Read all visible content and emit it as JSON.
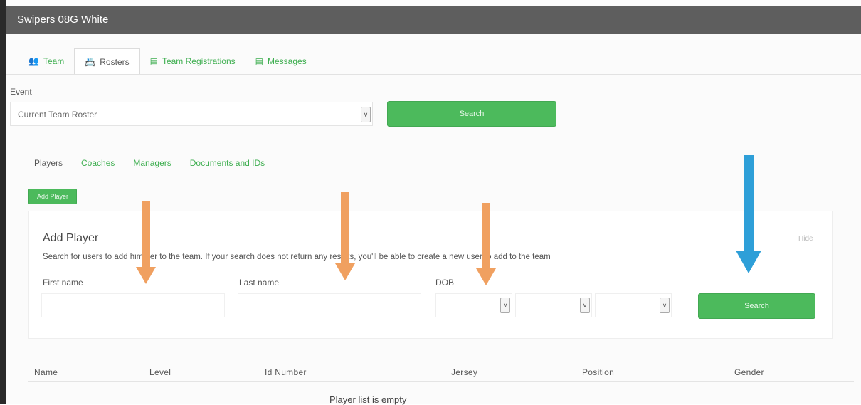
{
  "window": {
    "title": "Swipers 08G White"
  },
  "tabs": [
    {
      "label": "Team",
      "icon": "team-icon",
      "active": false
    },
    {
      "label": "Rosters",
      "icon": "roster-card-icon",
      "active": true
    },
    {
      "label": "Team Registrations",
      "icon": "list-icon",
      "active": false
    },
    {
      "label": "Messages",
      "icon": "list-icon",
      "active": false
    }
  ],
  "event": {
    "label": "Event",
    "selected": "Current Team Roster",
    "search_label": "Search"
  },
  "subtabs": [
    {
      "label": "Players",
      "active": true
    },
    {
      "label": "Coaches",
      "active": false
    },
    {
      "label": "Managers",
      "active": false
    },
    {
      "label": "Documents and IDs",
      "active": false
    }
  ],
  "add_player_button": "Add Player",
  "add_player": {
    "title": "Add Player",
    "hide_label": "Hide",
    "description": "Search for users to add him/her to the team. If your search does not return any results, you'll be able to create a new user to add to the team",
    "first_name_label": "First name",
    "last_name_label": "Last name",
    "dob_label": "DOB",
    "search_label": "Search"
  },
  "table": {
    "columns": [
      "Name",
      "Level",
      "Id Number",
      "Jersey",
      "Position",
      "Gender"
    ],
    "empty_text": "Player list is empty"
  },
  "colors": {
    "accent_green": "#4cba5c",
    "annotation_orange": "#f0a060",
    "annotation_blue": "#2e9fd8"
  }
}
